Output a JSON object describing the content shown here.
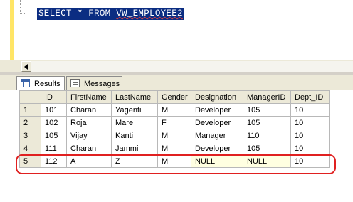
{
  "editor": {
    "sql_prefix": "SELECT * FROM ",
    "sql_object": "VW_EMPLOYEE2"
  },
  "tabs": [
    {
      "label": "Results",
      "icon": "grid-icon",
      "active": true
    },
    {
      "label": "Messages",
      "icon": "messages-icon",
      "active": false
    }
  ],
  "grid": {
    "columns": [
      "ID",
      "FirstName",
      "LastName",
      "Gender",
      "Designation",
      "ManagerID",
      "Dept_ID"
    ],
    "rows": [
      {
        "num": "1",
        "cells": [
          "101",
          "Charan",
          "Yagenti",
          "M",
          "Developer",
          "105",
          "10"
        ]
      },
      {
        "num": "2",
        "cells": [
          "102",
          "Roja",
          "Mare",
          "F",
          "Developer",
          "105",
          "10"
        ]
      },
      {
        "num": "3",
        "cells": [
          "105",
          "Vijay",
          "Kanti",
          "M",
          "Manager",
          "110",
          "10"
        ]
      },
      {
        "num": "4",
        "cells": [
          "111",
          "Charan",
          "Jammi",
          "M",
          "Developer",
          "105",
          "10"
        ]
      },
      {
        "num": "5",
        "cells": [
          "112",
          "A",
          "Z",
          "M",
          "NULL",
          "NULL",
          "10"
        ]
      }
    ],
    "highlighted_row": 5,
    "null_color": "#ffffe1",
    "highlight_color": "#e02020"
  }
}
